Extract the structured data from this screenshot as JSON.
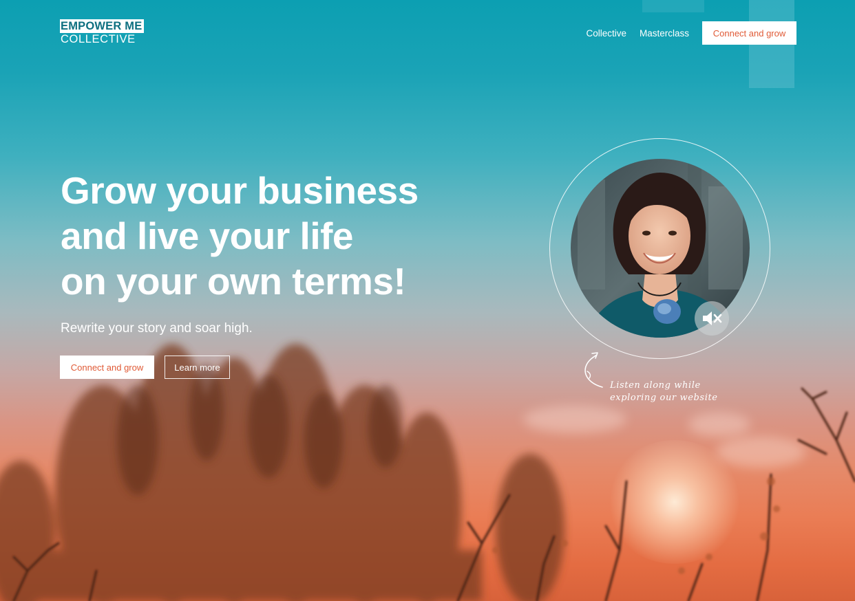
{
  "logo": {
    "line1": "EMPOWER ME",
    "line2": "COLLECTIVE"
  },
  "nav": {
    "items": [
      {
        "label": "Collective"
      },
      {
        "label": "Masterclass"
      }
    ],
    "cta_label": "Connect and grow"
  },
  "hero": {
    "title_lines": [
      "Grow your business",
      "and live your life",
      "on your own terms!"
    ],
    "subtitle": "Rewrite your story and soar high.",
    "primary_label": "Connect and grow",
    "secondary_label": "Learn more"
  },
  "audio": {
    "caption_lines": [
      "Listen along while",
      "exploring our website"
    ],
    "mute_icon": "speaker-muted-icon"
  },
  "colors": {
    "accent": "#e05a36",
    "brand_teal": "#0d6f80"
  }
}
